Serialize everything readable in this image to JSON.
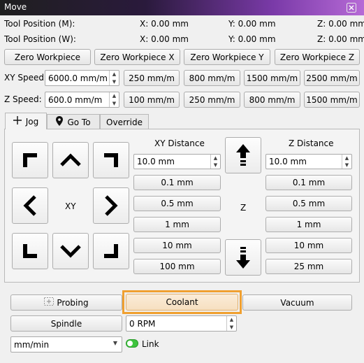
{
  "window": {
    "title": "Move",
    "close_icon": "close-icon"
  },
  "positions": {
    "machine": {
      "label": "Tool Position (M):",
      "x": "X: 0.00 mm",
      "y": "Y: 0.00 mm",
      "z": "Z: 0.00 mm"
    },
    "work": {
      "label": "Tool Position (W):",
      "x": "X: 0.00 mm",
      "y": "Y: 0.00 mm",
      "z": "Z: 0.00 mm"
    }
  },
  "zero_buttons": [
    "Zero Workpiece",
    "Zero Workpiece X",
    "Zero Workpiece Y",
    "Zero Workpiece Z"
  ],
  "xy_speed": {
    "label": "XY Speed:",
    "value": "6000.0 mm/m",
    "presets": [
      "250 mm/m",
      "800 mm/m",
      "1500 mm/m",
      "2500 mm/m"
    ]
  },
  "z_speed": {
    "label": "Z Speed:",
    "value": "600.0 mm/m",
    "presets": [
      "100 mm/m",
      "250 mm/m",
      "800 mm/m",
      "1500 mm/m"
    ]
  },
  "tabs": [
    {
      "label": "Jog",
      "icon": "move-cross-icon",
      "active": true
    },
    {
      "label": "Go To",
      "icon": "map-pin-icon",
      "active": false
    },
    {
      "label": "Override",
      "icon": "",
      "active": false
    }
  ],
  "jog": {
    "xy_center_label": "XY",
    "z_center_label": "Z",
    "xy_distance": {
      "label": "XY Distance",
      "value": "10.0 mm",
      "presets": [
        "0.1 mm",
        "0.5 mm",
        "1 mm",
        "10 mm",
        "100 mm"
      ]
    },
    "z_distance": {
      "label": "Z Distance",
      "value": "10.0 mm",
      "presets": [
        "0.1 mm",
        "0.5 mm",
        "1 mm",
        "10 mm",
        "25 mm"
      ]
    }
  },
  "actions": {
    "probing": "Probing",
    "coolant": "Coolant",
    "vacuum": "Vacuum",
    "spindle": "Spindle",
    "rpm_value": "0 RPM",
    "units_value": "mm/min",
    "link_label": "Link"
  },
  "colors": {
    "highlight": "#f0a030",
    "link_led": "#3ec43e",
    "titlebar_accent": "#b66ad6"
  }
}
